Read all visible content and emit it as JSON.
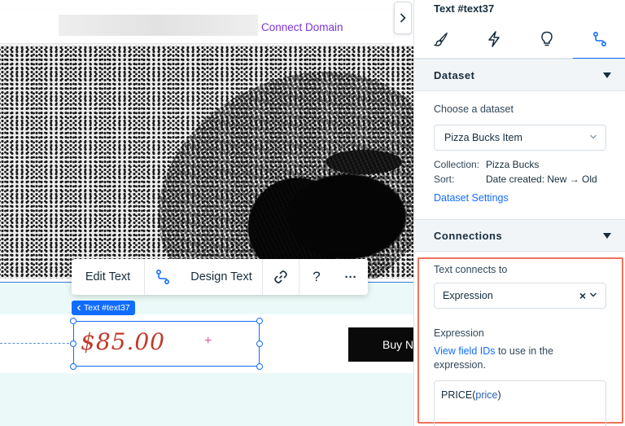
{
  "topbar": {
    "connect_domain": "Connect Domain"
  },
  "canvas": {
    "element_tag": "Text #text37",
    "price_text": "$85.00",
    "plus_mark": "+",
    "buy_button": "Buy Now"
  },
  "toolbar": {
    "edit_text": "Edit Text",
    "design_text": "Design Text",
    "help": "?",
    "more": "···"
  },
  "panel": {
    "title": "Text #text37",
    "tabs": [
      {
        "name": "design",
        "icon": "brush-icon"
      },
      {
        "name": "animation",
        "icon": "lightning-icon"
      },
      {
        "name": "settings",
        "icon": "lightbulb-icon"
      },
      {
        "name": "connect",
        "icon": "connect-icon",
        "active": true
      }
    ],
    "dataset_section": {
      "header": "Dataset",
      "choose_label": "Choose a dataset",
      "selected_dataset": "Pizza Bucks Item",
      "collection_key": "Collection:",
      "collection_value": "Pizza Bucks",
      "sort_key": "Sort:",
      "sort_value": "Date created: New → Old",
      "settings_link": "Dataset Settings"
    },
    "connections_section": {
      "header": "Connections",
      "connects_to_label": "Text connects to",
      "connects_to_value": "Expression",
      "clear_glyph": "×",
      "expression_label": "Expression",
      "view_ids_link": "View field IDs",
      "view_ids_suffix": " to use in the expression.",
      "expression_fn": "PRICE(",
      "expression_arg": "price",
      "expression_close": ")"
    }
  },
  "colors": {
    "accent": "#116dff",
    "connect_domain": "#7b36d8",
    "price": "#c03a2b",
    "highlight": "#ef735a",
    "strip": "#ebfaf8"
  }
}
